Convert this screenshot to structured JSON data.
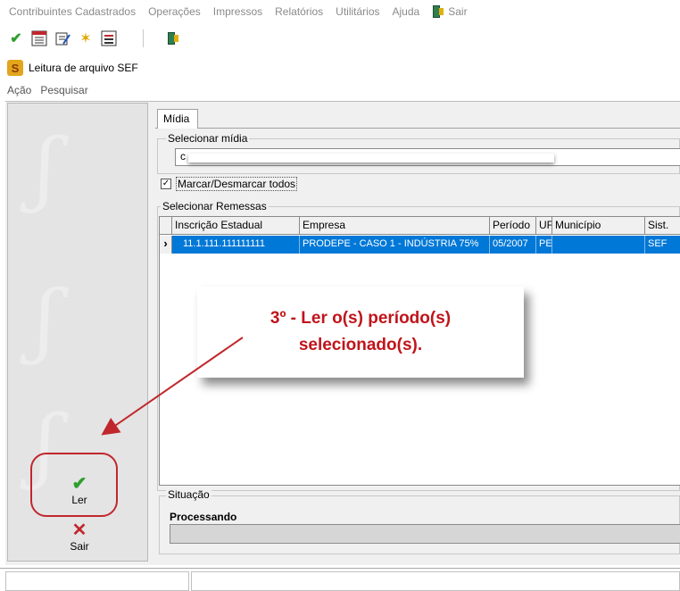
{
  "app_menu": {
    "items": [
      "Contribuintes Cadastrados",
      "Operações",
      "Impressos",
      "Relatórios",
      "Utilitários",
      "Ajuda"
    ],
    "exit_label": "Sair"
  },
  "toolbar": {
    "icons": [
      "check-icon",
      "calendar-icon",
      "document-edit-icon",
      "star-icon",
      "report-icon",
      "exit-door-icon"
    ]
  },
  "window": {
    "title": "Leitura de arquivo SEF",
    "menu": [
      "Ação",
      "Pesquisar"
    ]
  },
  "left_panel": {
    "read_label": "Ler",
    "exit_label": "Sair"
  },
  "tab": {
    "label": "Mídia"
  },
  "select_media": {
    "group_label": "Selecionar mídia",
    "value": "c"
  },
  "toggle_all": {
    "label": "Marcar/Desmarcar todos",
    "checked": true
  },
  "remessas": {
    "group_label": "Selecionar Remessas",
    "columns": [
      "Inscrição Estadual",
      "Empresa",
      "Período",
      "UF",
      "Município",
      "Sist."
    ],
    "rows": [
      {
        "inscricao": "11.1.111.111111111",
        "empresa": "PRODEPE - CASO 1 - INDÚSTRIA 75%",
        "periodo": "05/2007",
        "uf": "PE",
        "municipio": "",
        "sistema": "SEF"
      }
    ]
  },
  "callout": {
    "line1": "3º - Ler o(s) período(s)",
    "line2": "selecionado(s).",
    "color": "#c0141b"
  },
  "situacao": {
    "group_label": "Situação",
    "status": "Processando"
  },
  "colors": {
    "selection": "#0078d7",
    "highlight_ring": "#c0272d",
    "check_green": "#2e9e2e"
  }
}
